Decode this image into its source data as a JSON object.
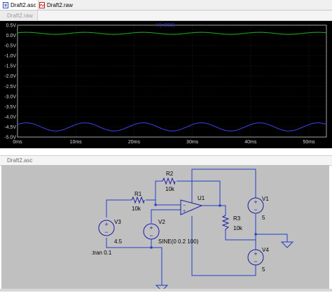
{
  "tabs": [
    {
      "label": "Draft2.asc",
      "icon": "schematic-icon",
      "active": true
    },
    {
      "label": "Draft2.raw",
      "icon": "waveform-icon",
      "active": false
    }
  ],
  "plot_pane": {
    "tab_label": "Draft2.raw",
    "trace_label": "V(n003)",
    "colors": {
      "background": "#000000",
      "axis": "#cfcfcf",
      "grid": "#3a3a3a",
      "trace": "#3b3bd9",
      "trace_top": "#1aa51a"
    }
  },
  "chart_data": {
    "type": "line",
    "ylim": [
      -5.0,
      0.5
    ],
    "xlim": [
      0,
      53
    ],
    "x_unit": "ms",
    "x_ticks": [
      "0ms",
      "10ms",
      "20ms",
      "30ms",
      "40ms",
      "50ms"
    ],
    "y_ticks": [
      "0.5V",
      "0.0V",
      "-0.5V",
      "-1.0V",
      "-1.5V",
      "-2.0V",
      "-2.5V",
      "-3.0V",
      "-3.5V",
      "-4.0V",
      "-4.5V",
      "-5.0V"
    ],
    "series": [
      {
        "name": "V(n003)",
        "color": "#3b3bd9",
        "offset": -4.5,
        "amplitude": 0.2,
        "period_ms": 10
      },
      {
        "color": "#1aa51a",
        "offset": 0.1,
        "amplitude": 0.05,
        "period_ms": 10
      }
    ]
  },
  "schematic": {
    "tab_label": "Draft2.asc",
    "components": {
      "r1": {
        "name": "R1",
        "value": "10k"
      },
      "r2": {
        "name": "R2",
        "value": "10k"
      },
      "r3": {
        "name": "R3",
        "value": "10k"
      },
      "u1": {
        "name": "U1"
      },
      "v1": {
        "name": "V1",
        "value": "5"
      },
      "v2": {
        "name": "V2",
        "value": "SINE(0 0.2 100)"
      },
      "v3": {
        "name": "V3",
        "value": "4.5"
      },
      "v4": {
        "name": "V4",
        "value": "5"
      }
    },
    "directive": ".tran 0.1",
    "colors": {
      "background": "#c0c0c0",
      "wire": "#1f3ec9",
      "component": "#1a1aa8"
    }
  }
}
